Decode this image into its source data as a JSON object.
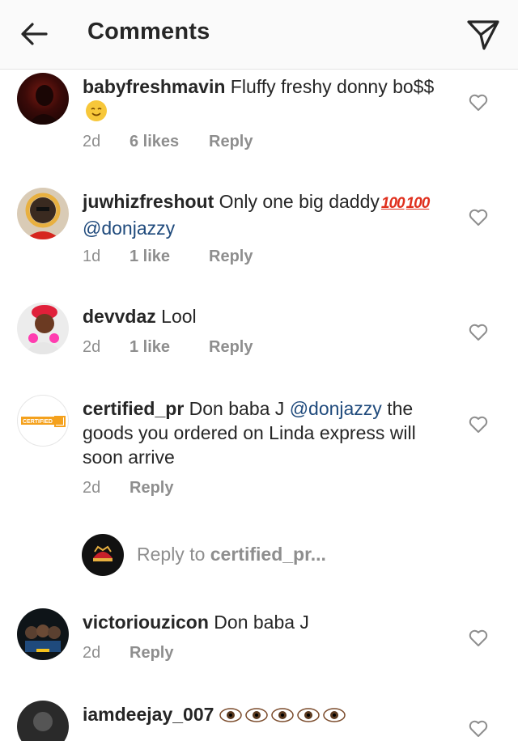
{
  "header": {
    "title": "Comments"
  },
  "comments": [
    {
      "username": "babyfreshmavin",
      "text": "Fluffy freshy donny bo$$",
      "time": "2d",
      "likes": "6 likes",
      "reply": "Reply"
    },
    {
      "username": "juwhizfreshout",
      "text": "Only one big daddy",
      "mention": "@donjazzy",
      "time": "1d",
      "likes": "1 like",
      "reply": "Reply"
    },
    {
      "username": "devvdaz",
      "text": "Lool",
      "time": "2d",
      "likes": "1 like",
      "reply": "Reply"
    },
    {
      "username": "certified_pr",
      "text_before": "Don baba J",
      "mention": "@donjazzy",
      "text_after": "the goods you ordered on Linda express will soon arrive",
      "avatar_label": "CERTIFIED",
      "time": "2d",
      "reply": "Reply"
    },
    {
      "username": "victoriouzicon",
      "text": "Don baba J",
      "time": "2d",
      "reply": "Reply"
    },
    {
      "username": "iamdeejay_007"
    }
  ],
  "reply_box": {
    "prefix": "Reply to",
    "target": "certified_pr..."
  },
  "colors": {
    "accent_link": "#1f4a7c",
    "muted": "#8e8e8e",
    "header_bg": "#fafafa"
  },
  "icons": {
    "back": "arrow-left-icon",
    "send": "paper-plane-icon",
    "like": "heart-outline-icon"
  }
}
